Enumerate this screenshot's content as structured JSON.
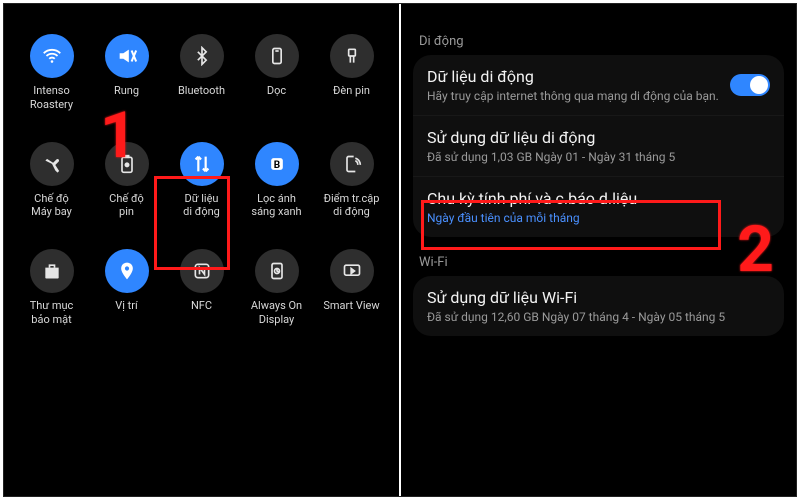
{
  "left": {
    "tiles": [
      {
        "id": "wifi",
        "label": "Intenso\nRoastery",
        "on": true
      },
      {
        "id": "sound",
        "label": "Rung",
        "on": true
      },
      {
        "id": "bluetooth",
        "label": "Bluetooth",
        "on": false
      },
      {
        "id": "rotate",
        "label": "Dọc",
        "on": false
      },
      {
        "id": "flash",
        "label": "Đèn pin",
        "on": false
      },
      {
        "id": "airplane",
        "label": "Chế độ\nMáy bay",
        "on": false
      },
      {
        "id": "battery",
        "label": "Chế độ\npin",
        "on": false
      },
      {
        "id": "data",
        "label": "Dữ liệu\ndi động",
        "on": true
      },
      {
        "id": "bluelight",
        "label": "Lọc ánh\nsáng xanh",
        "on": true
      },
      {
        "id": "hotspot",
        "label": "Điểm tr.cập\ndi động",
        "on": false
      },
      {
        "id": "secure",
        "label": "Thư mục\nbảo mật",
        "on": false
      },
      {
        "id": "location",
        "label": "Vị trí",
        "on": true
      },
      {
        "id": "nfc",
        "label": "NFC",
        "on": false
      },
      {
        "id": "aod",
        "label": "Always On\nDisplay",
        "on": false
      },
      {
        "id": "smartview",
        "label": "Smart View",
        "on": false
      }
    ]
  },
  "right": {
    "section_mobile": "Di động",
    "mobile": {
      "data_title": "Dữ liệu di động",
      "data_sub": "Hãy truy cập internet thông qua mạng di động của bạn.",
      "usage_title": "Sử dụng dữ liệu di động",
      "usage_sub": "Đã sử dụng 1,03 GB Ngày 01 - Ngày 31 tháng 5",
      "cycle_title": "Chu kỳ tính phí và c.báo d.liệu",
      "cycle_sub": "Ngày đầu tiên của mỗi tháng"
    },
    "section_wifi": "Wi-Fi",
    "wifi": {
      "usage_title": "Sử dụng dữ liệu Wi-Fi",
      "usage_sub": "Đã sử dụng 12,60 GB Ngày 07 tháng 4 - Ngày 05 tháng 5"
    }
  },
  "annot": {
    "one": "1",
    "two": "2"
  }
}
